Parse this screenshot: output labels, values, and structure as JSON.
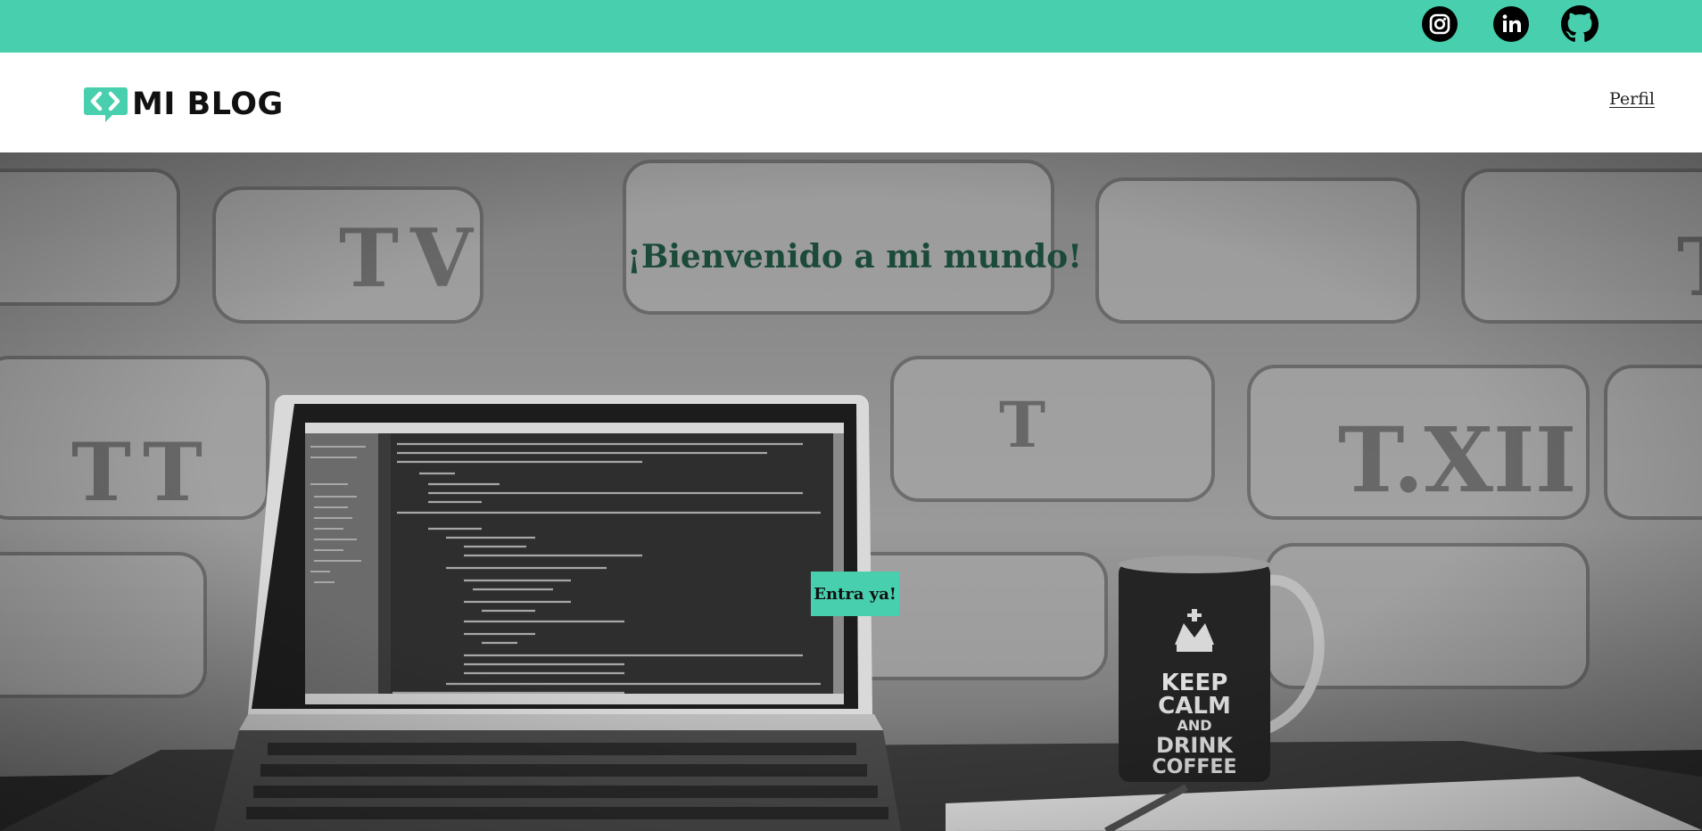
{
  "topbar": {
    "accent_color": "#48cfad",
    "social_links": [
      {
        "name": "instagram",
        "icon": "instagram-icon"
      },
      {
        "name": "linkedin",
        "icon": "linkedin-icon"
      },
      {
        "name": "github",
        "icon": "github-icon"
      }
    ]
  },
  "header": {
    "logo_text": "MI BLOG",
    "logo_icon": "code-bubble-icon",
    "nav_link": "Perfil"
  },
  "hero": {
    "title": "¡Bienvenido a mi mundo!",
    "cta_label": "Entra ya!",
    "background": "laptop-code-coffee-mug-brick-wall-photo",
    "mug_text": [
      "KEEP",
      "CALM",
      "AND",
      "DRINK",
      "COFFEE"
    ],
    "title_color": "#1b4a39"
  }
}
